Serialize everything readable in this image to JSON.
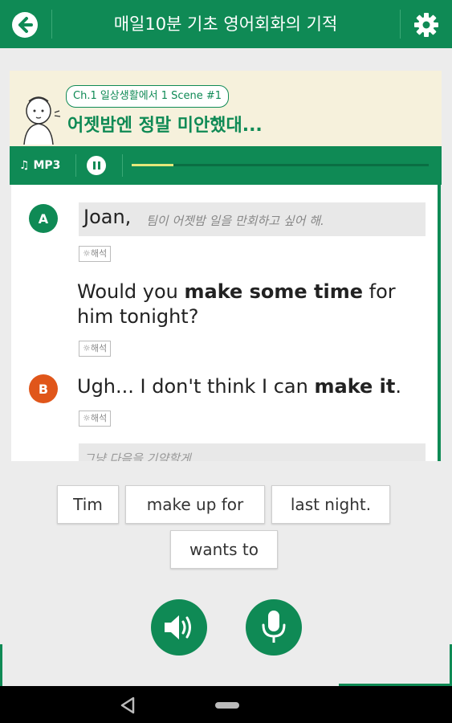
{
  "header": {
    "title": "매일10분 기초 영어회화의 기적"
  },
  "scene": {
    "chapter_chip": "Ch.1 일상생활에서 1 Scene #1",
    "title": "어젯밤엔 정말 미안했대..."
  },
  "player": {
    "mp3_label": "MP3",
    "progress": 0.14
  },
  "dialog": {
    "lines": [
      {
        "speaker": "A",
        "name": "Joan,",
        "translation": "팀이 어젯밤 일을 만회하고 싶어 해.",
        "hint": "해석"
      },
      {
        "speaker": "A",
        "pre": "Would you ",
        "bold": "make some time",
        "post": " for him tonight?",
        "hint": "해석"
      },
      {
        "speaker": "B",
        "pre": "Ugh... I don't think I can ",
        "bold": "make it",
        "post": ".",
        "hint": "해석"
      }
    ],
    "partial_translation": "그냥 다음을 기약할게."
  },
  "word_chips": [
    "Tim",
    "make up for",
    "last night.",
    "wants to"
  ],
  "colors": {
    "primary": "#0f8a55",
    "speaker_b": "#e0561a",
    "scene_bg": "#f6f1dc"
  },
  "icons": {
    "back": "back-arrow-icon",
    "settings": "gear-icon",
    "music": "music-note-icon",
    "pause": "pause-icon",
    "speaker": "speaker-icon",
    "mic": "microphone-icon",
    "hint": "lightbulb-icon"
  }
}
